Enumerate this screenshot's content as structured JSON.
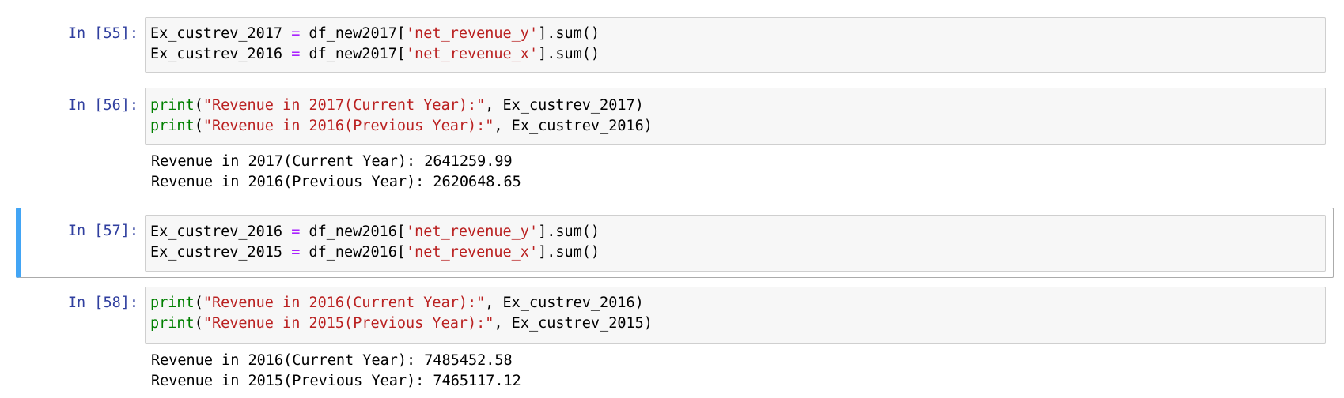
{
  "cells": [
    {
      "prompt": "In [55]:",
      "lines": [
        [
          {
            "t": "Ex_custrev_2017 ",
            "c": "var"
          },
          {
            "t": "=",
            "c": "op"
          },
          {
            "t": " df_new2017[",
            "c": "var"
          },
          {
            "t": "'net_revenue_y'",
            "c": "str"
          },
          {
            "t": "].sum()",
            "c": "punc"
          }
        ],
        [
          {
            "t": "Ex_custrev_2016 ",
            "c": "var"
          },
          {
            "t": "=",
            "c": "op"
          },
          {
            "t": " df_new2017[",
            "c": "var"
          },
          {
            "t": "'net_revenue_x'",
            "c": "str"
          },
          {
            "t": "].sum()",
            "c": "punc"
          }
        ]
      ],
      "outputs": []
    },
    {
      "prompt": "In [56]:",
      "lines": [
        [
          {
            "t": "print",
            "c": "fn"
          },
          {
            "t": "(",
            "c": "punc"
          },
          {
            "t": "\"Revenue in 2017(Current Year):\"",
            "c": "str"
          },
          {
            "t": ", Ex_custrev_2017)",
            "c": "punc"
          }
        ],
        [
          {
            "t": "print",
            "c": "fn"
          },
          {
            "t": "(",
            "c": "punc"
          },
          {
            "t": "\"Revenue in 2016(Previous Year):\"",
            "c": "str"
          },
          {
            "t": ", Ex_custrev_2016)",
            "c": "punc"
          }
        ]
      ],
      "outputs": [
        "Revenue in 2017(Current Year): 2641259.99",
        "Revenue in 2016(Previous Year): 2620648.65"
      ]
    },
    {
      "prompt": "In [57]:",
      "selected": true,
      "lines": [
        [
          {
            "t": "Ex_custrev_2016 ",
            "c": "var"
          },
          {
            "t": "=",
            "c": "op"
          },
          {
            "t": " df_new2016[",
            "c": "var"
          },
          {
            "t": "'net_revenue_y'",
            "c": "str"
          },
          {
            "t": "].sum()",
            "c": "punc"
          }
        ],
        [
          {
            "t": "Ex_custrev_2015 ",
            "c": "var"
          },
          {
            "t": "=",
            "c": "op"
          },
          {
            "t": " df_new2016[",
            "c": "var"
          },
          {
            "t": "'net_revenue_x'",
            "c": "str"
          },
          {
            "t": "].sum()",
            "c": "punc"
          }
        ]
      ],
      "outputs": []
    },
    {
      "prompt": "In [58]:",
      "lines": [
        [
          {
            "t": "print",
            "c": "fn"
          },
          {
            "t": "(",
            "c": "punc"
          },
          {
            "t": "\"Revenue in 2016(Current Year):\"",
            "c": "str"
          },
          {
            "t": ", Ex_custrev_2016)",
            "c": "punc"
          }
        ],
        [
          {
            "t": "print",
            "c": "fn"
          },
          {
            "t": "(",
            "c": "punc"
          },
          {
            "t": "\"Revenue in 2015(Previous Year):\"",
            "c": "str"
          },
          {
            "t": ", Ex_custrev_2015)",
            "c": "punc"
          }
        ]
      ],
      "outputs": [
        "Revenue in 2016(Current Year): 7485452.58",
        "Revenue in 2015(Previous Year): 7465117.12"
      ]
    }
  ]
}
